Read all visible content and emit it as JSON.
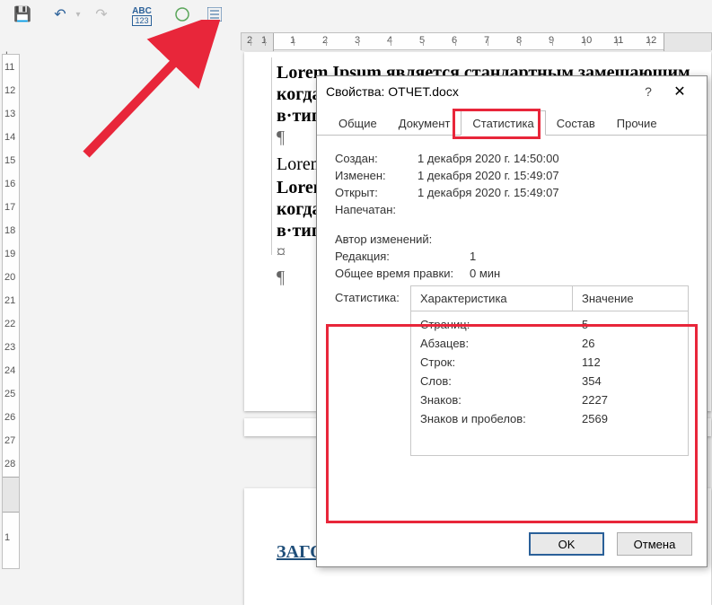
{
  "toolbar": {
    "icons": [
      "save",
      "undo",
      "redo",
      "spellcheck",
      "circle",
      "list"
    ]
  },
  "ruler": {
    "corner": "L",
    "h": [
      "2",
      "1",
      "1",
      "2",
      "3",
      "4",
      "5",
      "6",
      "7",
      "8",
      "9",
      "10",
      "11",
      "12"
    ],
    "v": [
      "11",
      "12",
      "13",
      "14",
      "15",
      "16",
      "17",
      "18",
      "19",
      "20",
      "21",
      "22",
      "23",
      "24",
      "25",
      "26",
      "27",
      "28"
    ],
    "v2": [
      "1"
    ]
  },
  "doc": {
    "l1": "Lorem Ipsum является стандартным замещающим",
    "l2": "когда·н",
    "l3": "в·типогр",
    "l4": "¶",
    "l5": "Lorem·I",
    "l6": "Lorem·I",
    "l7": "когда·н",
    "l8": "в·типогр",
    "l9": "¤",
    "l10": "¶",
    "h2": "ЗАГОЛОВО"
  },
  "dialog": {
    "title": "Свойства: ОТЧЕТ.docx",
    "help": "?",
    "close": "✕",
    "tabs": [
      "Общие",
      "Документ",
      "Статистика",
      "Состав",
      "Прочие"
    ],
    "active_tab": 2,
    "dates": {
      "created_lbl": "Создан:",
      "created_val": "1 декабря 2020 г. 14:50:00",
      "modified_lbl": "Изменен:",
      "modified_val": "1 декабря 2020 г. 15:49:07",
      "opened_lbl": "Открыт:",
      "opened_val": "1 декабря 2020 г. 15:49:07",
      "printed_lbl": "Напечатан:",
      "printed_val": ""
    },
    "rev": {
      "author_lbl": "Автор изменений:",
      "author_val": "",
      "revision_lbl": "Редакция:",
      "revision_val": "1",
      "time_lbl": "Общее время правки:",
      "time_val": "0 мин"
    },
    "stats": {
      "section_lbl": "Статистика:",
      "head_char": "Характеристика",
      "head_val": "Значение",
      "rows": [
        {
          "k": "Страниц:",
          "v": "5"
        },
        {
          "k": "Абзацев:",
          "v": "26"
        },
        {
          "k": "Строк:",
          "v": "112"
        },
        {
          "k": "Слов:",
          "v": "354"
        },
        {
          "k": "Знаков:",
          "v": "2227"
        },
        {
          "k": "Знаков и пробелов:",
          "v": "2569"
        }
      ]
    },
    "ok": "OK",
    "cancel": "Отмена"
  }
}
